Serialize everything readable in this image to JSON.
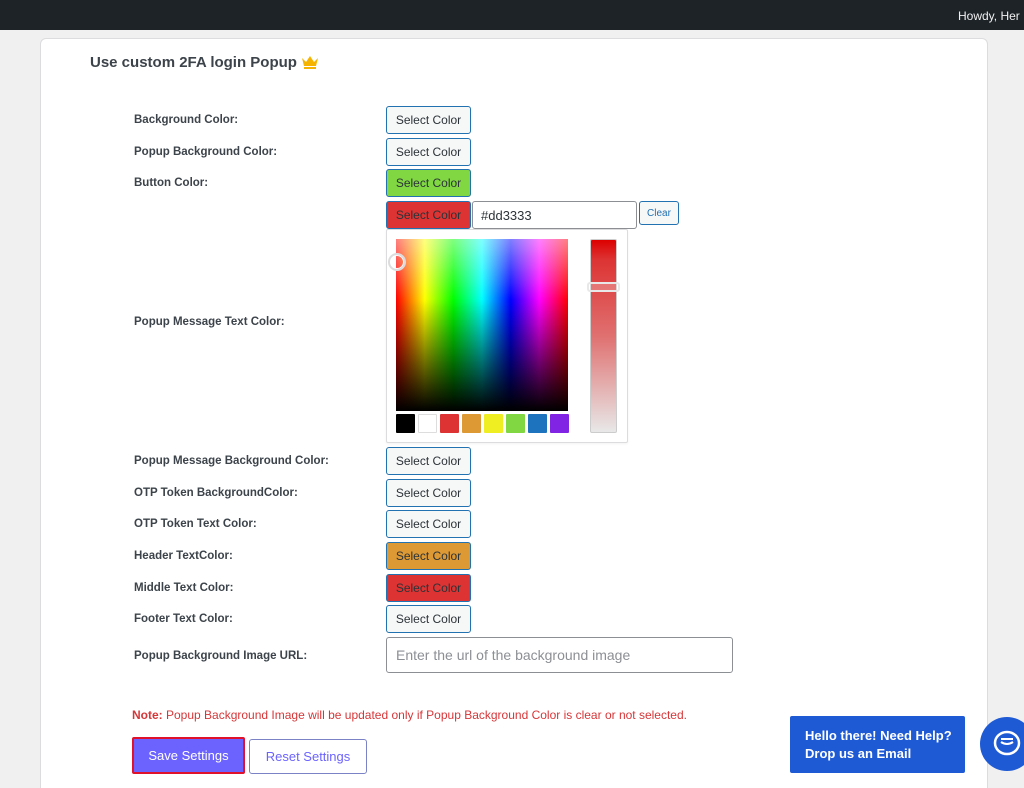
{
  "adminbar": {
    "greeting": "Howdy, Her"
  },
  "section": {
    "title": "Use custom 2FA login Popup",
    "crown_icon": "crown-icon"
  },
  "fields": [
    {
      "label": "Background Color:",
      "button": "Select Color"
    },
    {
      "label": "Popup Background Color:",
      "button": "Select Color"
    },
    {
      "label": "Button Color:",
      "button": "Select Color",
      "color": "#81d742"
    },
    {
      "label": "Popup Message Text Color:",
      "button": "Select Color",
      "color": "#dd3333"
    },
    {
      "label": "Popup Message Background Color:",
      "button": "Select Color"
    },
    {
      "label": "OTP Token BackgroundColor:",
      "button": "Select Color"
    },
    {
      "label": "OTP Token Text Color:",
      "button": "Select Color"
    },
    {
      "label": "Header TextColor:",
      "button": "Select Color",
      "color": "#dd9933"
    },
    {
      "label": "Middle Text Color:",
      "button": "Select Color",
      "color": "#dd3333"
    },
    {
      "label": "Footer Text Color:",
      "button": "Select Color"
    }
  ],
  "picker": {
    "hex_value": "#dd3333",
    "clear_label": "Clear",
    "palette": [
      "#000000",
      "#ffffff",
      "#dd3333",
      "#dd9933",
      "#eeee22",
      "#81d742",
      "#1e73be",
      "#8224e3"
    ]
  },
  "image_url": {
    "label": "Popup Background Image URL:",
    "placeholder": "Enter the url of the background image"
  },
  "note": {
    "prefix": "Note:",
    "text": " Popup Background Image will be updated only if Popup Background Color is clear or not selected."
  },
  "buttons": {
    "save": "Save Settings",
    "reset": "Reset Settings"
  },
  "help": {
    "line1": "Hello there! Need Help?",
    "line2": "Drop us an Email",
    "icon": "chat-icon"
  }
}
